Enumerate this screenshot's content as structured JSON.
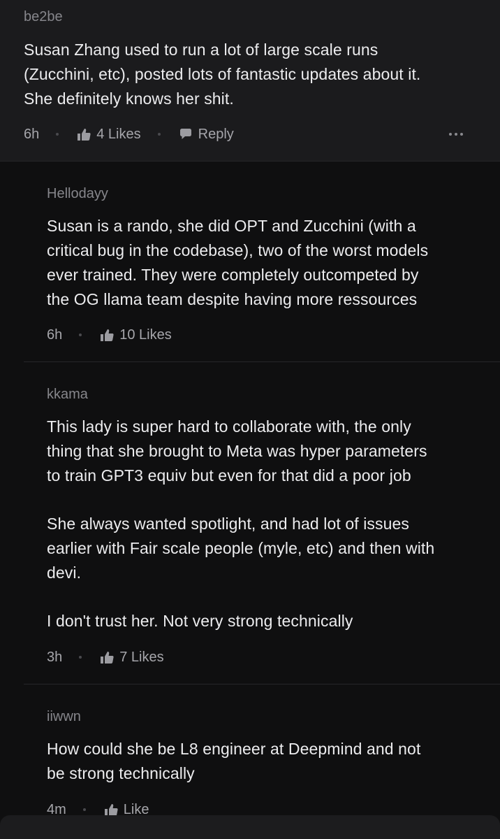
{
  "comments": [
    {
      "username": "be2be",
      "lines": [
        "Susan Zhang used to run a lot of large scale runs",
        "(Zucchini, etc), posted lots of fantastic updates about it.",
        "She definitely knows her shit."
      ],
      "time": "6h",
      "likes": "4 Likes",
      "reply": "Reply"
    },
    {
      "username": "Hellodayy",
      "lines": [
        "Susan is a rando, she did OPT and Zucchini (with a",
        "critical bug in the codebase), two of the worst models",
        "ever trained. They were completely outcompeted by",
        "the OG llama team despite having more ressources"
      ],
      "time": "6h",
      "likes": "10 Likes"
    },
    {
      "username": "kkama",
      "lines": [
        "This lady is super hard to collaborate with, the only",
        "thing that she brought to Meta was hyper parameters",
        "to train GPT3 equiv but even for that did a poor job",
        "She always wanted spotlight, and had lot of issues",
        "earlier with Fair scale people (myle, etc) and then with",
        "devi.",
        "I don't trust her. Not very strong technically"
      ],
      "time": "3h",
      "likes": "7 Likes"
    },
    {
      "username": "iiwwn",
      "lines": [
        "How could she be L8 engineer at Deepmind and not",
        "be strong technically"
      ],
      "time": "4m",
      "likes": "Like"
    }
  ],
  "icons": {
    "like": "thumbs-up-icon",
    "reply": "speech-bubble-icon",
    "more": "more-horizontal-icon"
  },
  "colors": {
    "background": "#0f0f10",
    "top_comment_background": "#1b1b1d",
    "username": "#86868b",
    "text": "#ececee",
    "meta": "#a6a6ab"
  }
}
